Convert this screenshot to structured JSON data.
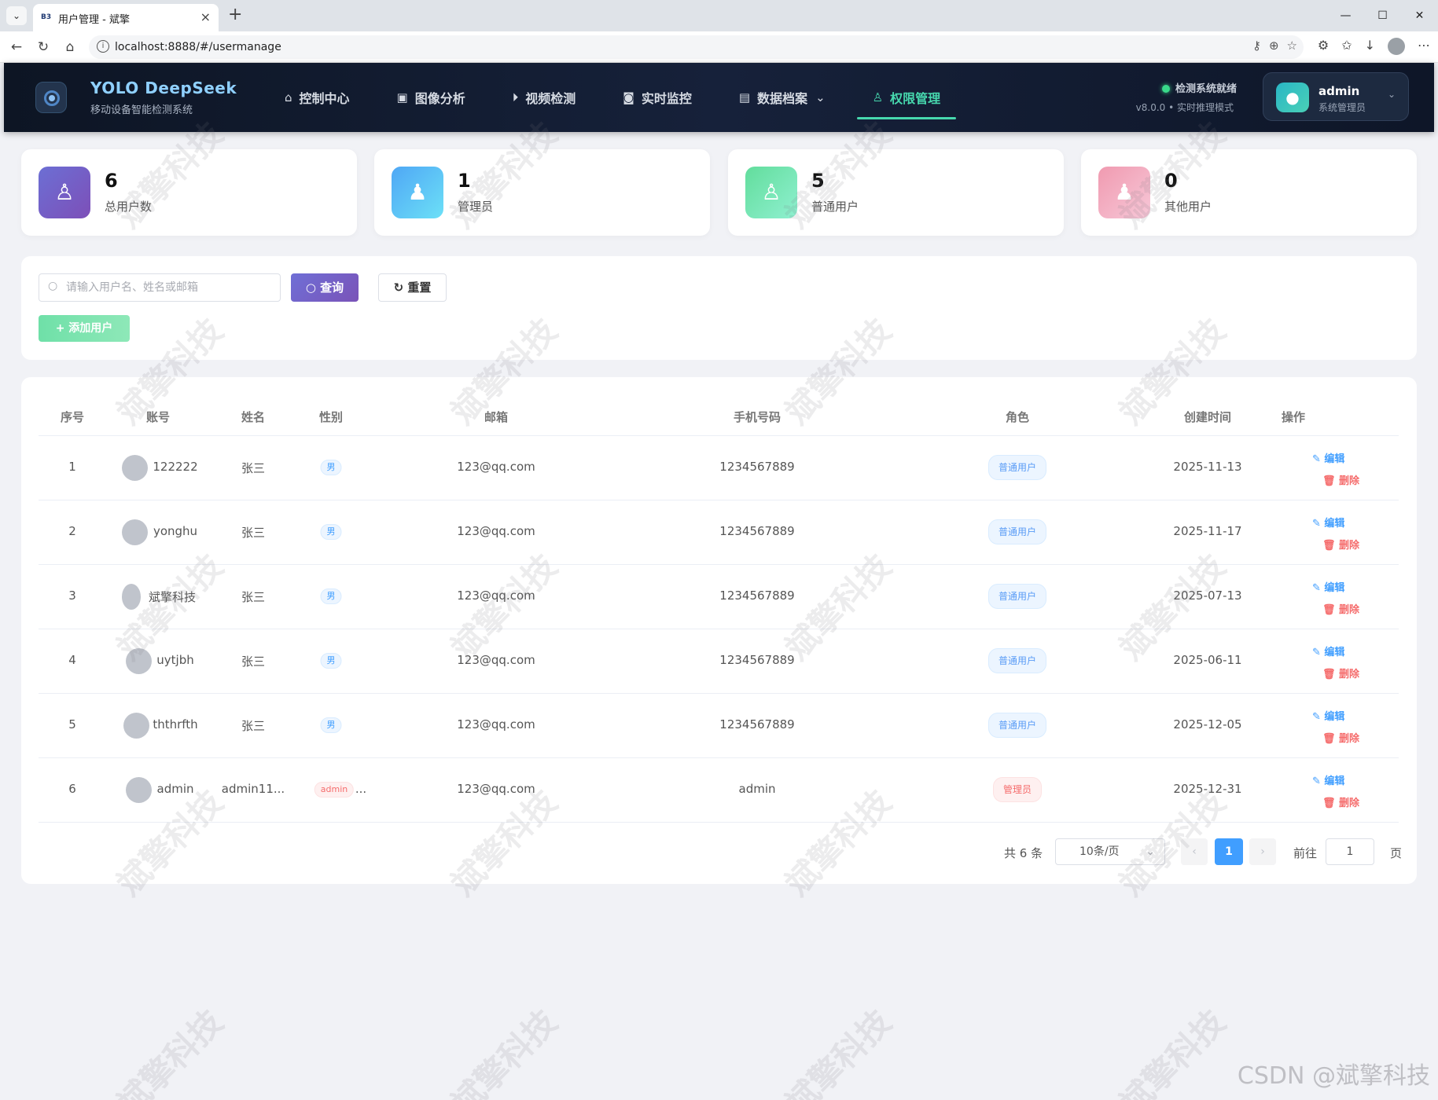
{
  "browser": {
    "tab_title": "用户管理 - 斌擎",
    "tab_favicon": "B3",
    "url": "localhost:8888/#/usermanage"
  },
  "header": {
    "brand_title": "YOLO DeepSeek",
    "brand_subtitle": "移动设备智能检测系统",
    "nav": [
      {
        "label": "控制中心",
        "icon": "home-icon"
      },
      {
        "label": "图像分析",
        "icon": "image-icon"
      },
      {
        "label": "视频检测",
        "icon": "play-icon"
      },
      {
        "label": "实时监控",
        "icon": "camera-icon"
      },
      {
        "label": "数据档案",
        "icon": "document-icon"
      },
      {
        "label": "权限管理",
        "icon": "user-icon"
      }
    ],
    "status_text": "检测系统就绪",
    "status_sub": "v8.0.0 • 实时推理模式",
    "user_name": "admin",
    "user_role": "系统管理员"
  },
  "stats": [
    {
      "value": "6",
      "label": "总用户数",
      "color": "#7b5cc7"
    },
    {
      "value": "1",
      "label": "管理员",
      "color": "#4ab3f4"
    },
    {
      "value": "5",
      "label": "普通用户",
      "color": "#6ee3ab"
    },
    {
      "value": "0",
      "label": "其他用户",
      "color": "#f2a9b8"
    }
  ],
  "search": {
    "placeholder": "请输入用户名、姓名或邮箱",
    "query_label": "查询",
    "reset_label": "重置",
    "add_label": "添加用户"
  },
  "table": {
    "columns": [
      "序号",
      "账号",
      "姓名",
      "性别",
      "邮箱",
      "手机号码",
      "角色",
      "创建时间",
      "操作"
    ],
    "rows": [
      {
        "index": "1",
        "account": "122222",
        "name": "张三",
        "gender": "男",
        "email": "123@qq.com",
        "phone": "1234567889",
        "role": "普通用户",
        "created": "2025-11-13"
      },
      {
        "index": "2",
        "account": "yonghu",
        "name": "张三",
        "gender": "男",
        "email": "123@qq.com",
        "phone": "1234567889",
        "role": "普通用户",
        "created": "2025-11-17"
      },
      {
        "index": "3",
        "account": "斌擎科技",
        "name": "张三",
        "gender": "男",
        "email": "123@qq.com",
        "phone": "1234567889",
        "role": "普通用户",
        "created": "2025-07-13"
      },
      {
        "index": "4",
        "account": "uytjbh",
        "name": "张三",
        "gender": "男",
        "email": "123@qq.com",
        "phone": "1234567889",
        "role": "普通用户",
        "created": "2025-06-11"
      },
      {
        "index": "5",
        "account": "ththrfth",
        "name": "张三",
        "gender": "男",
        "email": "123@qq.com",
        "phone": "1234567889",
        "role": "普通用户",
        "created": "2025-12-05"
      },
      {
        "index": "6",
        "account": "admin",
        "name": "admin11...",
        "gender": "admin",
        "gender_suffix": "...",
        "email": "123@qq.com",
        "phone": "admin",
        "role": "管理员",
        "created": "2025-12-31"
      }
    ],
    "edit_label": "编辑",
    "delete_label": "删除"
  },
  "pagination": {
    "total": "共 6 条",
    "page_size": "10条/页",
    "current_page": "1",
    "goto_label": "前往",
    "goto_value": "1",
    "page_unit": "页"
  },
  "watermark": "斌擎科技",
  "csdn": "CSDN @斌擎科技"
}
